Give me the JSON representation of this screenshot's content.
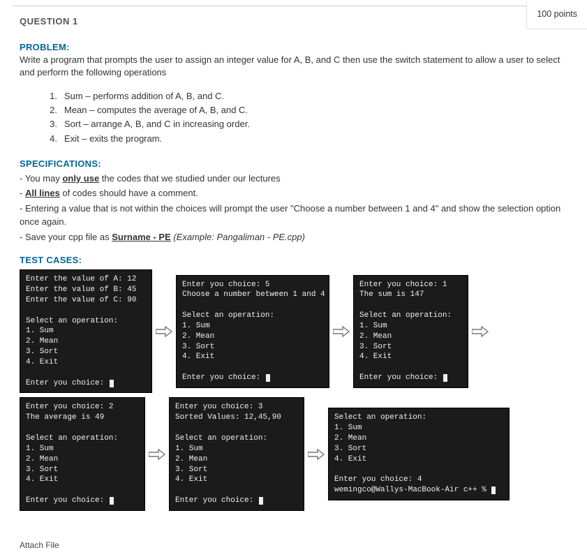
{
  "header": {
    "question_label": "QUESTION 1",
    "points": "100 points"
  },
  "problem": {
    "heading": "PROBLEM:",
    "text": "Write a program that prompts the user to assign an integer value for A, B, and C then use the switch statement to allow a user to select and perform the following operations"
  },
  "operations": [
    {
      "num": "1.",
      "text": "Sum – performs addition of A, B, and C."
    },
    {
      "num": "2.",
      "text": "Mean – computes the average of A, B, and C."
    },
    {
      "num": "3.",
      "text": "Sort – arrange A, B, and C in increasing order."
    },
    {
      "num": "4.",
      "text": "Exit – exits the program."
    }
  ],
  "specifications": {
    "heading": "SPECIFICATIONS:",
    "items": {
      "a_pre": "- You may ",
      "a_u": "only use",
      "a_post": " the codes that we studied under our lectures",
      "b_pre": "- ",
      "b_u": "All lines",
      "b_post": " of codes should have a comment.",
      "c": "- Entering a value that is not within the choices will prompt the user \"Choose a number between 1 and 4\" and show the selection option once again.",
      "d_pre": "- Save your cpp file as ",
      "d_u": "Surname - PE",
      "d_post_i": " (Example: Pangaliman - PE.cpp)"
    }
  },
  "testcases": {
    "heading": "TEST CASES:",
    "t1": "Enter the value of A: 12\nEnter the value of B: 45\nEnter the value of C: 90\n\nSelect an operation:\n1. Sum\n2. Mean\n3. Sort\n4. Exit\n\nEnter you choice: ",
    "t2": "Enter you choice: 5\nChoose a number between 1 and 4\n\nSelect an operation:\n1. Sum\n2. Mean\n3. Sort\n4. Exit\n\nEnter you choice: ",
    "t3": "Enter you choice: 1\nThe sum is 147\n\nSelect an operation:\n1. Sum\n2. Mean\n3. Sort\n4. Exit\n\nEnter you choice: ",
    "t4": "Enter you choice: 2\nThe average is 49\n\nSelect an operation:\n1. Sum\n2. Mean\n3. Sort\n4. Exit\n\nEnter you choice: ",
    "t5": "Enter you choice: 3\nSorted Values: 12,45,90\n\nSelect an operation:\n1. Sum\n2. Mean\n3. Sort\n4. Exit\n\nEnter you choice: ",
    "t6": "Select an operation:\n1. Sum\n2. Mean\n3. Sort\n4. Exit\n\nEnter you choice: 4\nwemingco@Wallys-MacBook-Air c++ % "
  },
  "attach_label": "Attach File"
}
